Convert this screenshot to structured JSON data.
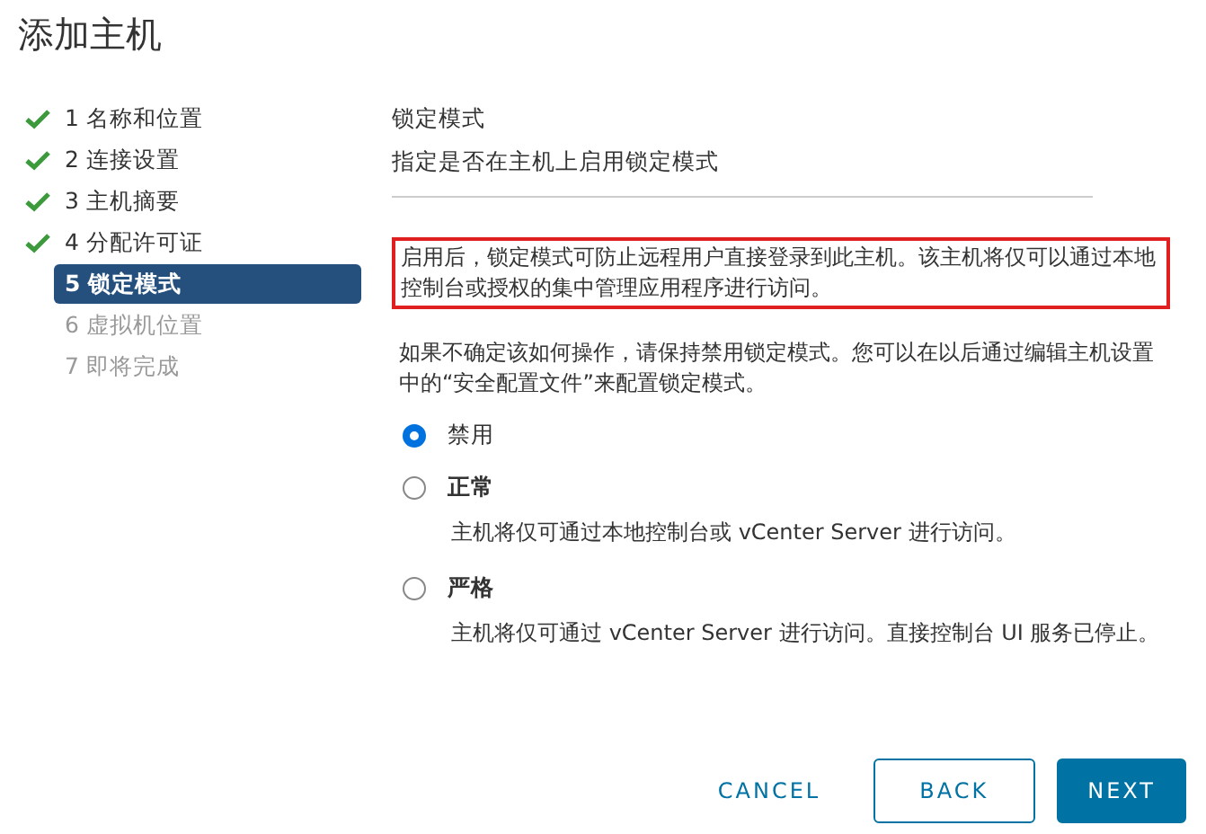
{
  "window": {
    "title": "添加主机"
  },
  "steps": [
    {
      "label": "1 名称和位置",
      "completed": true,
      "selected": false,
      "disabled": false
    },
    {
      "label": "2 连接设置",
      "completed": true,
      "selected": false,
      "disabled": false
    },
    {
      "label": "3 主机摘要",
      "completed": true,
      "selected": false,
      "disabled": false
    },
    {
      "label": "4 分配许可证",
      "completed": true,
      "selected": false,
      "disabled": false
    },
    {
      "label": "5 锁定模式",
      "completed": false,
      "selected": true,
      "disabled": false
    },
    {
      "label": "6 虚拟机位置",
      "completed": false,
      "selected": false,
      "disabled": true
    },
    {
      "label": "7 即将完成",
      "completed": false,
      "selected": false,
      "disabled": true
    }
  ],
  "section": {
    "title": "锁定模式",
    "subtitle": "指定是否在主机上启用锁定模式"
  },
  "notice": {
    "text": "启用后，锁定模式可防止远程用户直接登录到此主机。该主机将仅可以通过本地控制台或授权的集中管理应用程序进行访问。",
    "highlighted": true
  },
  "hint": "如果不确定该如何操作，请保持禁用锁定模式。您可以在以后通过编辑主机设置中的“安全配置文件”来配置锁定模式。",
  "options": [
    {
      "label": "禁用",
      "selected": true
    },
    {
      "label": "正常",
      "selected": false,
      "description": "主机将仅可通过本地控制台或 vCenter Server 进行访问。"
    },
    {
      "label": "严格",
      "selected": false,
      "description": "主机将仅可通过 vCenter Server 进行访问。直接控制台 UI 服务已停止。"
    }
  ],
  "buttons": [
    {
      "label": "CANCEL",
      "kind": "flat"
    },
    {
      "label": "BACK",
      "kind": "outline"
    },
    {
      "label": "NEXT",
      "kind": "primary"
    }
  ]
}
